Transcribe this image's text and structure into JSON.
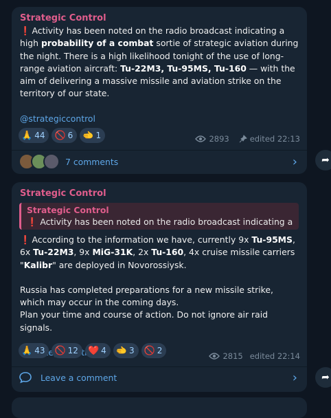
{
  "post1": {
    "author": "Strategic Control",
    "bang": "❗",
    "text_1": "Activity has been noted on the radio broadcast indicating a high ",
    "bold_1": "probability of a combat",
    "text_2": "  sortie of strategic aviation during the night. There is a high likelihood tonight of the use of long-range aviation aircraft: ",
    "bold_2": "Tu-22M3, Tu-95MS, Tu-160",
    "text_3": " — with the aim of delivering a massive missile and aviation strike on the territory of our state.",
    "link": "@strategiccontrol",
    "reactions": [
      {
        "icon": "folded-hands",
        "emoji": "🙏",
        "count": "44"
      },
      {
        "icon": "no-russia-flag",
        "emoji": "🚫",
        "count": "6"
      },
      {
        "icon": "pointing-hand",
        "emoji": "🫲",
        "count": "1"
      }
    ],
    "views": "2893",
    "edited": "edited 22:13",
    "comments": "7 comments"
  },
  "post2": {
    "author": "Strategic Control",
    "quote_author": "Strategic Control",
    "quote_text": "❗ Activity has been noted on the radio broadcast indicating a h...",
    "bang": "❗",
    "text_1": "According to the information we have, currently 9x ",
    "bold_1": "Tu-95MS",
    "text_2": ", 6x ",
    "bold_2": "Tu-22M3",
    "text_3": ", 9x ",
    "bold_3": "MiG-31K",
    "text_4": ", 2x ",
    "bold_4": "Tu-160",
    "text_5": ", 4x cruise missile carriers \"",
    "bold_5": "Kalibr",
    "text_6": "\" are deployed in Novorossiysk.",
    "para_2": "Russia has completed preparations for a new missile strike, which may occur in the coming days.",
    "para_3": "Plan your time and course of action. Do not ignore air raid signals.",
    "link": "@strategiccontrol",
    "reactions": [
      {
        "icon": "folded-hands",
        "emoji": "🙏",
        "count": "43"
      },
      {
        "icon": "no-russia-flag",
        "emoji": "🚫",
        "count": "12"
      },
      {
        "icon": "heart",
        "emoji": "❤️",
        "count": "4"
      },
      {
        "icon": "pointing-hand",
        "emoji": "🫲",
        "count": "3"
      },
      {
        "icon": "no-face",
        "emoji": "🚫",
        "count": "2"
      }
    ],
    "views": "2815",
    "edited": "edited 22:14",
    "comment_action": "Leave a comment"
  },
  "colors": {
    "background": "#0e1621",
    "bubble": "#182533",
    "author": "#e05d8c",
    "link": "#5ea7e8"
  }
}
